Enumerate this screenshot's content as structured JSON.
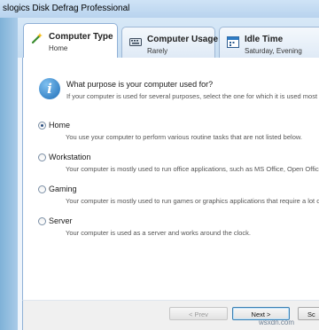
{
  "window": {
    "title": "slogics Disk Defrag Professional"
  },
  "tabs": [
    {
      "title": "Computer Type",
      "subtitle": "Home",
      "icon": "wizard-wand-icon"
    },
    {
      "title": "Computer Usage",
      "subtitle": "Rarely",
      "icon": "keyboard-icon"
    },
    {
      "title": "Idle Time",
      "subtitle": "Saturday, Evening",
      "icon": "calendar-icon"
    }
  ],
  "content": {
    "question": "What purpose is your computer used for?",
    "note": "If your computer is used for several purposes, select the one for which it is used most of the",
    "options": [
      {
        "label": "Home",
        "description": "You use your computer to perform various routine tasks that are not listed below.",
        "selected": true
      },
      {
        "label": "Workstation",
        "description": "Your computer is mostly used to run office applications, such as MS Office, Open Office e",
        "selected": false
      },
      {
        "label": "Gaming",
        "description": "Your computer is mostly used to run games or graphics applications that require a lot of s",
        "selected": false
      },
      {
        "label": "Server",
        "description": "Your computer is used as a server and works around the clock.",
        "selected": false
      }
    ]
  },
  "footer": {
    "prev_label": "< Prev",
    "next_label": "Next >",
    "cut_label": "Sc"
  },
  "watermark": "wsxdn.com",
  "colors": {
    "accent": "#1f6fb8",
    "tab_border": "#8fb0d6"
  }
}
